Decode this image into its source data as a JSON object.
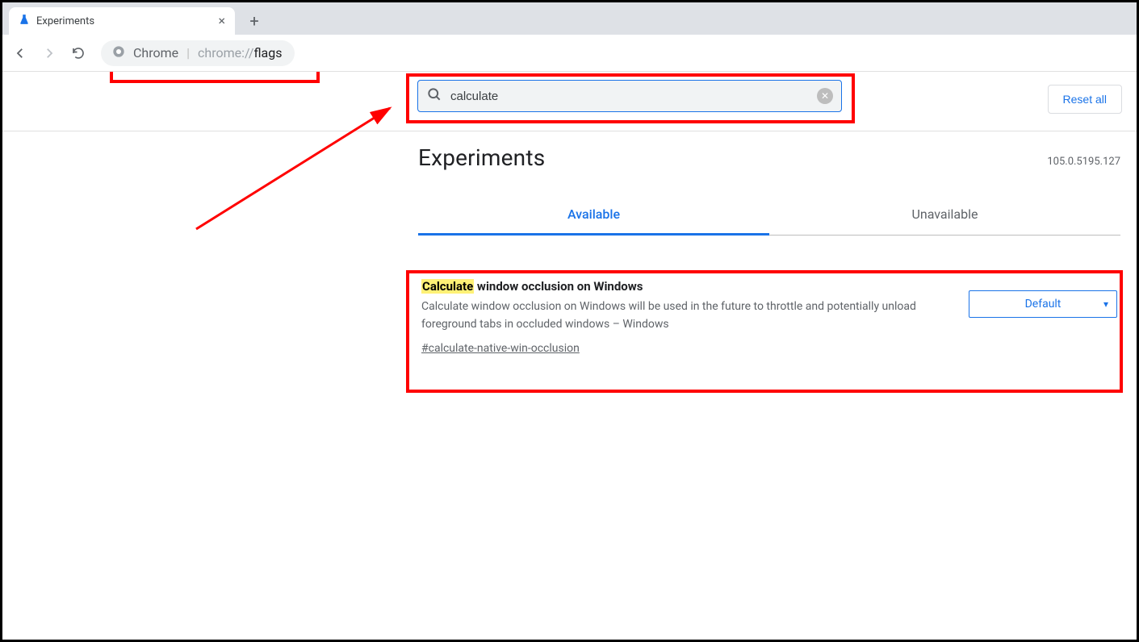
{
  "browser": {
    "tab_title": "Experiments",
    "address_label": "Chrome",
    "address_dim": "chrome://",
    "address_path": "flags"
  },
  "search": {
    "value": "calculate"
  },
  "buttons": {
    "reset_all": "Reset all"
  },
  "page": {
    "title": "Experiments",
    "version": "105.0.5195.127",
    "tab_available": "Available",
    "tab_unavailable": "Unavailable"
  },
  "flag": {
    "title_highlight": "Calculate",
    "title_rest": " window occlusion on Windows",
    "description": "Calculate window occlusion on Windows will be used in the future to throttle and potentially unload foreground tabs in occluded windows – Windows",
    "id": "#calculate-native-win-occlusion",
    "select_value": "Default"
  }
}
